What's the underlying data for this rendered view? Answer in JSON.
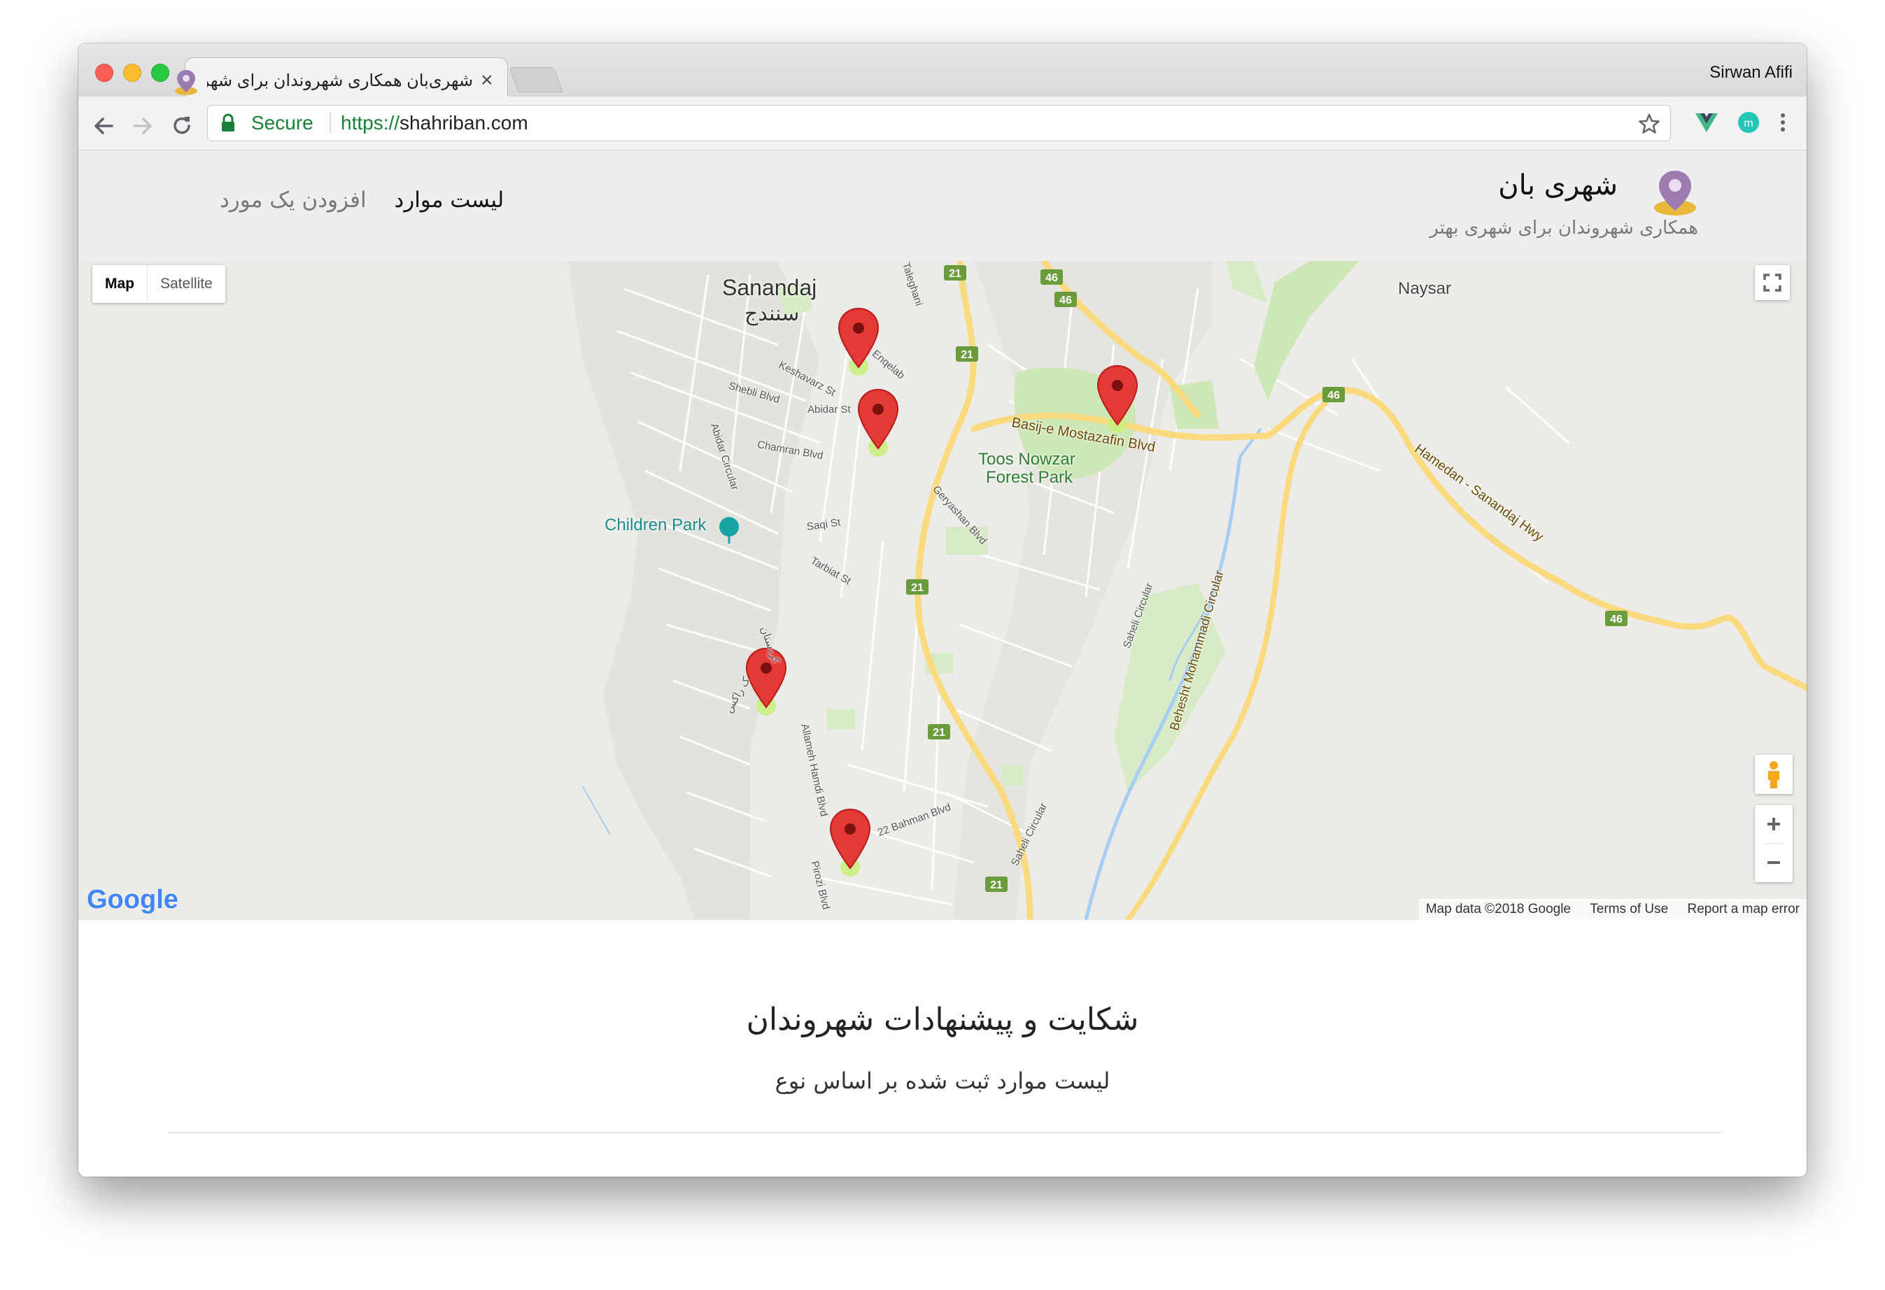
{
  "browser": {
    "tab_title": "شهری‌بان همکاری شهروندان برای شهری بهتر",
    "profile_name": "Sirwan Afifi",
    "secure_label": "Secure",
    "url_scheme": "https://",
    "url_host": "shahriban.com"
  },
  "header": {
    "brand_name": "شهری بان",
    "brand_tagline": "همکاری شهروندان برای شهری بهتر",
    "nav": [
      {
        "label": "لیست موارد",
        "active": true
      },
      {
        "label": "افزودن یک مورد",
        "active": false
      }
    ]
  },
  "map": {
    "type_options": [
      "Map",
      "Satellite"
    ],
    "selected_type": "Map",
    "labels": {
      "city_en": "Sanandaj",
      "city_fa": "سنندج",
      "naysar": "Naysar",
      "toos1": "Toos Nowzar",
      "toos2": "Forest Park",
      "children_park": "Children Park",
      "basij": "Basij-e Mostazafin Blvd",
      "hwy": "Hamedan - Sanandaj Hwy",
      "beheshti": "Behesht Mohammadi Circular",
      "keshavarz": "Keshavarz St",
      "shebli": "Shebli Blvd",
      "abidar_st": "Abidar St",
      "abidar_circ": "Abidar Circular",
      "chamran": "Chamran Blvd",
      "enqelab": "Enqelab",
      "taleghani": "Taleghani",
      "geryashan": "Geryashan Blvd",
      "saqi": "Saqi St",
      "tarbiat": "Tarbiat St",
      "saheli1": "Saheli Circular",
      "saheli2": "Saheli Circular",
      "allameh": "Allameh Hamdi Blvd",
      "bahman": "22 Bahman Blvd",
      "pirozi": "Pirozi Blvd",
      "kordestan": "کردستان",
      "azadi": "ک راکس"
    },
    "road_shields": [
      "21",
      "21",
      "21",
      "21",
      "21",
      "46",
      "46",
      "46",
      "46"
    ],
    "marker_count": 5,
    "attribution": {
      "data": "Map data ©2018 Google",
      "terms": "Terms of Use",
      "report": "Report a map error"
    },
    "logo_text": "Google",
    "colors": {
      "land": "#ecebe7",
      "park": "#cde8b6",
      "water": "#a8cdf5",
      "highway": "#f9da7f",
      "marker": "#e53935"
    }
  },
  "content": {
    "title": "شکایت و پیشنهادات شهروندان",
    "subtitle": "لیست موارد ثبت شده بر اساس نوع"
  },
  "colors": {
    "secure_green": "#188038",
    "header_bg": "#eeeeee",
    "brand_pin_purple": "#9b7bb0",
    "brand_pin_gold": "#e7b83a"
  }
}
